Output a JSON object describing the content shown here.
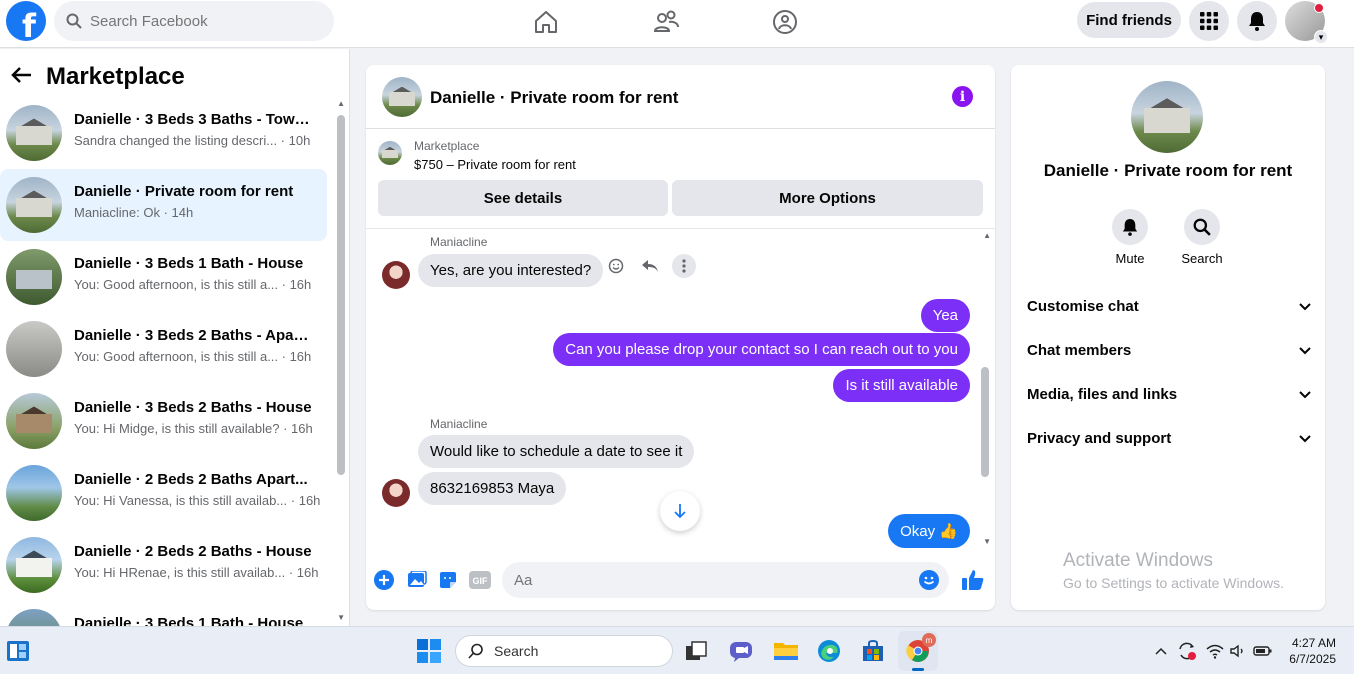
{
  "topbar": {
    "logo": "f",
    "search_placeholder": "Search Facebook",
    "find_friends": "Find friends",
    "nav_icons": [
      "home-icon",
      "friends-icon",
      "groups-icon"
    ]
  },
  "sidebar": {
    "title": "Marketplace",
    "conversations": [
      {
        "title": "Danielle · 3 Beds 3 Baths - Town...",
        "subtitle": "Sandra changed the listing descri... · 10h"
      },
      {
        "title": "Danielle · Private room for rent",
        "subtitle": "Maniacline: Ok · 14h"
      },
      {
        "title": "Danielle · 3 Beds 1 Bath - House",
        "subtitle": "You: Good afternoon, is this still a... · 16h"
      },
      {
        "title": "Danielle · 3 Beds 2 Baths - Apart...",
        "subtitle": "You: Good afternoon, is this still a... · 16h"
      },
      {
        "title": "Danielle · 3 Beds 2 Baths - House",
        "subtitle": "You: Hi Midge, is this still available? · 16h"
      },
      {
        "title": "Danielle · 2 Beds 2 Baths Apart...",
        "subtitle": "You: Hi Vanessa, is this still availab... · 16h"
      },
      {
        "title": "Danielle · 2 Beds 2 Baths - House",
        "subtitle": "You: Hi HRenae, is this still availab... · 16h"
      },
      {
        "title": "Danielle · 3 Beds 1 Bath - House",
        "subtitle": ""
      }
    ]
  },
  "chat": {
    "title": "Danielle · Private room for rent",
    "listing": {
      "category": "Marketplace",
      "price_title": "$750 – Private room for rent",
      "see_details": "See details",
      "more_options": "More Options"
    },
    "messages": {
      "sender1": "Maniacline",
      "in1": "Yes, are you interested?",
      "out1": "Yea",
      "out2": "Can you please drop your contact so I can reach out to you",
      "out3": "Is it still available",
      "sender2": "Maniacline",
      "in2": "Would like to schedule a date  to see it",
      "in3": "8632169853 Maya",
      "out4": "Okay 👍"
    },
    "composer_placeholder": "Aa"
  },
  "details": {
    "title": "Danielle · Private room for rent",
    "mute": "Mute",
    "search": "Search",
    "rows": [
      "Customise chat",
      "Chat members",
      "Media, files and links",
      "Privacy and support"
    ]
  },
  "watermark": {
    "line1": "Activate Windows",
    "line2": "Go to Settings to activate Windows."
  },
  "taskbar": {
    "search": "Search",
    "time": "4:27 AM",
    "date": "6/7/2025"
  },
  "colors": {
    "brand": "#1877f2",
    "outgoing_bubble": "#7b2ff7",
    "active_conv": "#e7f3ff"
  }
}
